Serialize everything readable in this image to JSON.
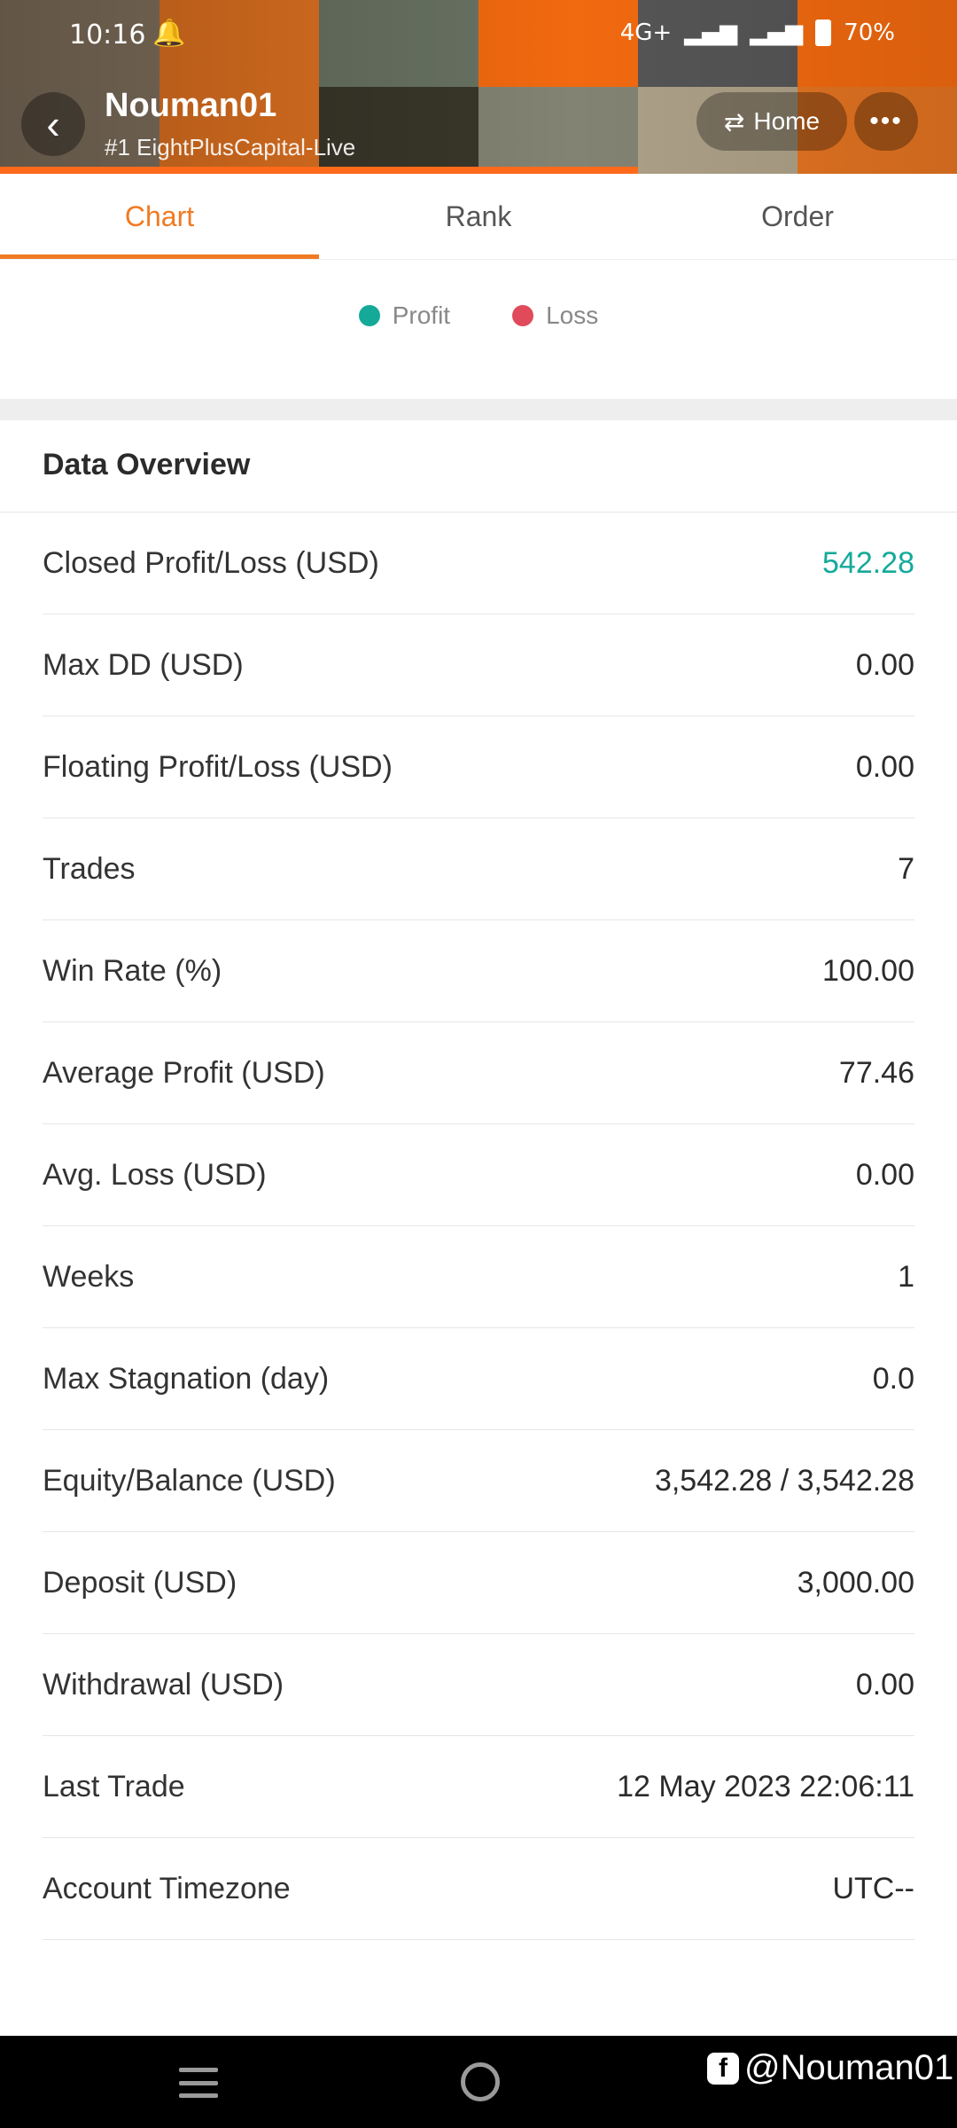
{
  "status_bar": {
    "time": "10:16",
    "network": "4G+",
    "battery": "70%"
  },
  "header": {
    "title": "Nouman01",
    "subtitle": "#1  EightPlusCapital-Live",
    "home_label": "Home",
    "more_label": "•••"
  },
  "tabs": [
    {
      "label": "Chart",
      "active": true
    },
    {
      "label": "Rank",
      "active": false
    },
    {
      "label": "Order",
      "active": false
    }
  ],
  "legend": [
    {
      "label": "Profit",
      "color": "#15a99a"
    },
    {
      "label": "Loss",
      "color": "#e04a5a"
    }
  ],
  "overview": {
    "title": "Data Overview",
    "rows": [
      {
        "label": "Closed Profit/Loss (USD)",
        "value": "542.28"
      },
      {
        "label": "Max DD (USD)",
        "value": "0.00"
      },
      {
        "label": "Floating Profit/Loss (USD)",
        "value": "0.00"
      },
      {
        "label": "Trades",
        "value": "7"
      },
      {
        "label": "Win Rate (%)",
        "value": "100.00"
      },
      {
        "label": "Average Profit (USD)",
        "value": "77.46"
      },
      {
        "label": "Avg. Loss (USD)",
        "value": "0.00"
      },
      {
        "label": "Weeks",
        "value": "1"
      },
      {
        "label": "Max Stagnation (day)",
        "value": "0.0"
      },
      {
        "label": "Equity/Balance (USD)",
        "value": "3,542.28 / 3,542.28"
      },
      {
        "label": "Deposit (USD)",
        "value": "3,000.00"
      },
      {
        "label": "Withdrawal (USD)",
        "value": "0.00"
      },
      {
        "label": "Last Trade",
        "value": "12 May 2023 22:06:11"
      },
      {
        "label": "Account Timezone",
        "value": "UTC--"
      }
    ]
  },
  "watermark": {
    "text": "@Nouman01"
  }
}
